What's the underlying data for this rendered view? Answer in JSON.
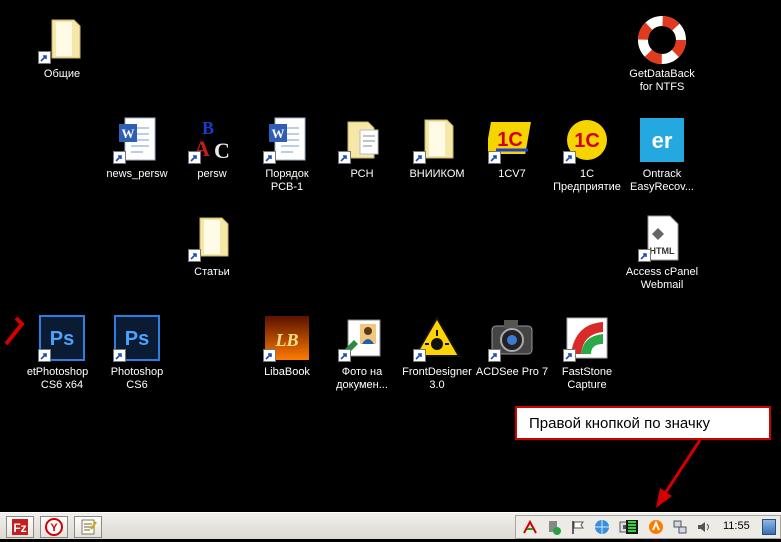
{
  "desktop": {
    "icons": [
      {
        "label": "Общие"
      },
      {
        "label": "GetDataBack\nfor NTFS"
      },
      {
        "label": "news_persw"
      },
      {
        "label": "persw"
      },
      {
        "label": "Порядок\nРСВ-1"
      },
      {
        "label": "РСН"
      },
      {
        "label": "ВНИИКОМ"
      },
      {
        "label": "1CV7"
      },
      {
        "label": "1С\nПредприятие"
      },
      {
        "label": "Ontrack\nEasyRecov..."
      },
      {
        "label": "Статьи"
      },
      {
        "label": "Access cPanel\nWebmail"
      },
      {
        "label": "et"
      },
      {
        "label": "Photoshop\nCS6 x64"
      },
      {
        "label": "Photoshop\nCS6"
      },
      {
        "label": "LibaBook"
      },
      {
        "label": "Фото на\nдокумен..."
      },
      {
        "label": "FrontDesigner\n3.0"
      },
      {
        "label": "ACDSee Pro 7"
      },
      {
        "label": "FastStone\nCapture"
      }
    ]
  },
  "callout": {
    "text": "Правой кнопкой по значку",
    "border_color": "#d40000"
  },
  "taskbar": {
    "buttons": [
      {
        "icon": "filezilla-icon"
      },
      {
        "icon": "yandex-browser-icon"
      },
      {
        "icon": "notepad-icon"
      }
    ],
    "tray_icons": [
      "language-icon",
      "safely-remove-icon",
      "action-center-flag-icon",
      "network-globe-icon",
      "monitor-bars-icon",
      "avast-icon",
      "network-icon",
      "volume-icon"
    ],
    "clock": "11:55"
  }
}
